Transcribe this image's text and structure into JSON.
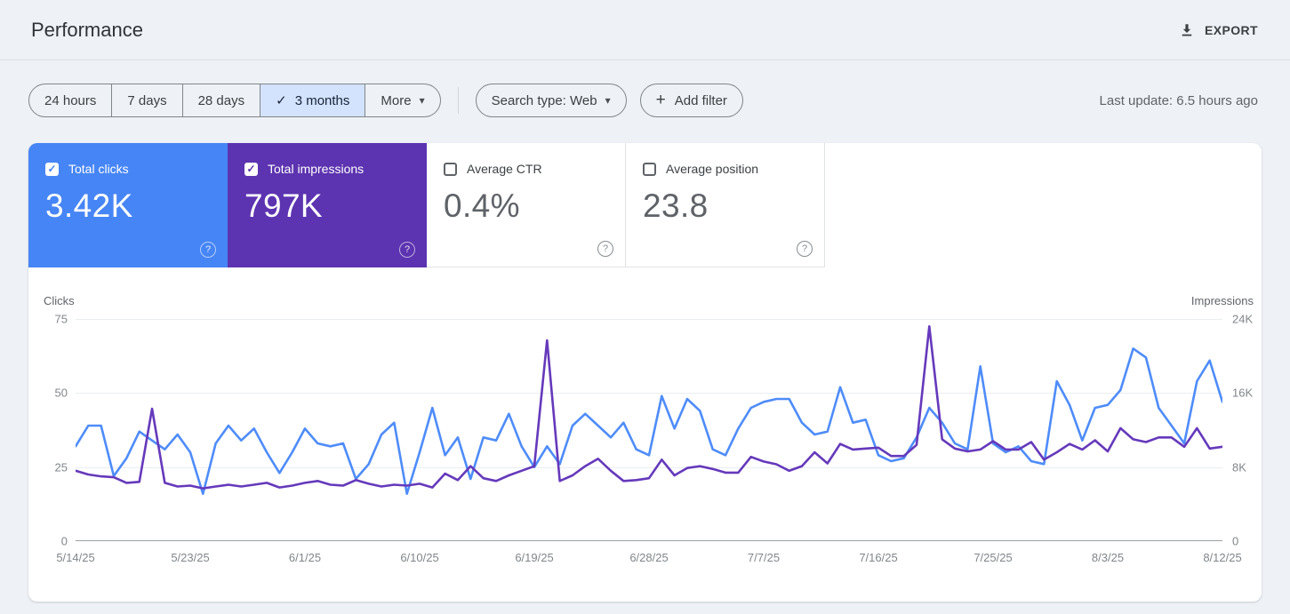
{
  "header": {
    "title": "Performance",
    "export_label": "EXPORT"
  },
  "icons": {
    "check": "✓",
    "caret": "▾",
    "plus": "+",
    "help": "?",
    "export": "download-icon"
  },
  "filters": {
    "date_ranges": [
      {
        "label": "24 hours",
        "selected": false
      },
      {
        "label": "7 days",
        "selected": false
      },
      {
        "label": "28 days",
        "selected": false
      },
      {
        "label": "3 months",
        "selected": true
      }
    ],
    "more_label": "More",
    "search_type_label": "Search type: Web",
    "add_filter_label": "Add filter",
    "last_update": "Last update: 6.5 hours ago"
  },
  "metrics": [
    {
      "label": "Total clicks",
      "value": "3.42K",
      "checked": true,
      "bg": "#4685f5"
    },
    {
      "label": "Total impressions",
      "value": "797K",
      "checked": true,
      "bg": "#5c33b0"
    },
    {
      "label": "Average CTR",
      "value": "0.4%",
      "checked": false,
      "bg": "#ffffff"
    },
    {
      "label": "Average position",
      "value": "23.8",
      "checked": false,
      "bg": "#ffffff"
    }
  ],
  "chart_data": {
    "type": "line",
    "num_points": 91,
    "date_start": "5/14/25",
    "date_end": "8/12/25",
    "x_tick_labels": [
      "5/14/25",
      "5/23/25",
      "6/1/25",
      "6/10/25",
      "6/19/25",
      "6/28/25",
      "7/7/25",
      "7/16/25",
      "7/25/25",
      "8/3/25",
      "8/12/25"
    ],
    "left_axis": {
      "label": "Clicks",
      "ticks": [
        "75",
        "50",
        "25",
        "0"
      ],
      "max": 75
    },
    "right_axis": {
      "label": "Impressions",
      "ticks": [
        "24K",
        "16K",
        "8K",
        "0"
      ],
      "max_k": 24
    },
    "grid": true,
    "legend_position": "none",
    "series": [
      {
        "name": "Total clicks",
        "axis": "left",
        "color": "#4e8cf9",
        "values": [
          32,
          39,
          39,
          22,
          28,
          37,
          34,
          31,
          36,
          30,
          16,
          33,
          39,
          34,
          38,
          30,
          23,
          30,
          38,
          33,
          32,
          33,
          21,
          26,
          36,
          40,
          16,
          30,
          45,
          29,
          35,
          21,
          35,
          34,
          43,
          32,
          25,
          32,
          26,
          39,
          43,
          39,
          35,
          40,
          31,
          29,
          49,
          38,
          48,
          44,
          31,
          29,
          38,
          45,
          47,
          48,
          48,
          40,
          36,
          37,
          52,
          40,
          41,
          29,
          27,
          28,
          35,
          45,
          40,
          33,
          31,
          59,
          33,
          30,
          32,
          27,
          26,
          54,
          46,
          34,
          45,
          46,
          51,
          65,
          62,
          45,
          39,
          33,
          54,
          61,
          47
        ]
      },
      {
        "name": "Total impressions",
        "axis": "right",
        "color": "#6539bb",
        "values_unit": "thousands",
        "values": [
          7.6,
          7.2,
          7.0,
          6.9,
          6.3,
          6.4,
          14.3,
          6.3,
          5.9,
          6.0,
          5.7,
          5.9,
          6.1,
          5.9,
          6.1,
          6.3,
          5.8,
          6.0,
          6.3,
          6.5,
          6.1,
          6.0,
          6.6,
          6.2,
          5.9,
          6.1,
          6.0,
          6.2,
          5.8,
          7.3,
          6.6,
          8.1,
          6.8,
          6.5,
          7.1,
          7.6,
          8.1,
          21.7,
          6.5,
          7.1,
          8.1,
          8.9,
          7.6,
          6.5,
          6.6,
          6.8,
          8.8,
          7.1,
          7.9,
          8.1,
          7.8,
          7.4,
          7.4,
          9.1,
          8.6,
          8.3,
          7.6,
          8.1,
          9.6,
          8.4,
          10.5,
          9.9,
          10.0,
          10.1,
          9.2,
          9.2,
          10.4,
          23.2,
          11.0,
          10.0,
          9.7,
          9.9,
          10.8,
          9.9,
          9.9,
          10.7,
          8.8,
          9.6,
          10.5,
          9.9,
          10.9,
          9.7,
          12.2,
          11.0,
          10.7,
          11.2,
          11.2,
          10.2,
          12.2,
          10.0,
          10.2
        ]
      }
    ]
  }
}
